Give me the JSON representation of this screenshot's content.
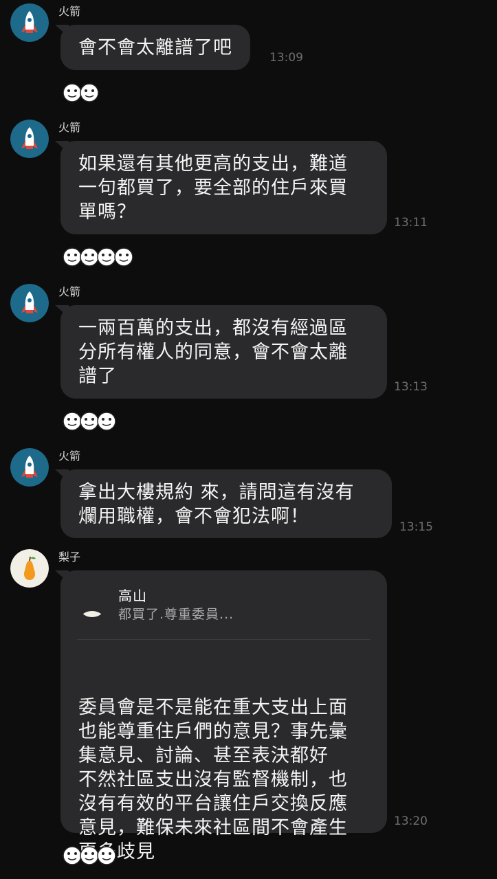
{
  "messages": [
    {
      "sender": "火箭",
      "avatar_icon": "rocket-icon",
      "text": "會不會太離譜了吧",
      "time": "13:09",
      "reaction_count": 2
    },
    {
      "sender": "火箭",
      "avatar_icon": "rocket-icon",
      "text": "如果還有其他更高的支出，難道\n一句都買了，要全部的住戶來買\n單嗎？",
      "time": "13:11",
      "reaction_count": 4
    },
    {
      "sender": "火箭",
      "avatar_icon": "rocket-icon",
      "text": "一兩百萬的支出，都沒有經過區\n分所有權人的同意，會不會太離\n譜了",
      "time": "13:13",
      "reaction_count": 3
    },
    {
      "sender": "火箭",
      "avatar_icon": "rocket-icon",
      "text": "拿出大樓規約 來，請問這有沒有\n爛用職權，會不會犯法啊！",
      "time": "13:15",
      "reaction_count": 0
    },
    {
      "sender": "梨子",
      "avatar_icon": "pear-icon",
      "reply_to": {
        "name": "高山",
        "avatar_icon": "mountain-icon",
        "text": "都買了.尊重委員..."
      },
      "text": "委員會是不是能在重大支出上面\n也能尊重住戶們的意見？事先彙\n集意見、討論、甚至表決都好\n不然社區支出沒有監督機制，也\n沒有有效的平台讓住戶交換反應\n意見，難保未來社區間不會產生\n更多歧見",
      "time": "13:20",
      "reaction_count": 3
    }
  ],
  "colors": {
    "background": "#0d0d0d",
    "bubble": "#2a2a2c",
    "rocket_avatar_bg": "#1e6a8a",
    "pear_avatar_bg": "#f2efe6",
    "mountain_avatar_bg": "#f2efe6"
  }
}
